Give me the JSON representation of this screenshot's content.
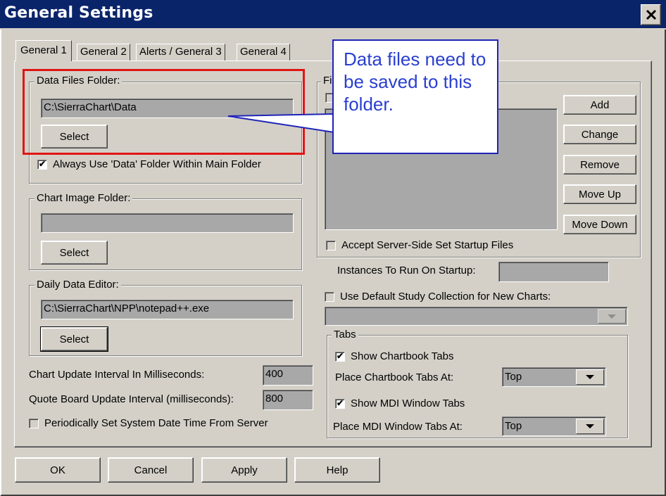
{
  "window": {
    "title": "General Settings"
  },
  "tabs": [
    "General 1",
    "General 2",
    "Alerts / General 3",
    "General 4"
  ],
  "data_files": {
    "legend": "Data Files Folder:",
    "value": "C:\\SierraChart\\Data",
    "select_label": "Select",
    "checkbox_label": "Always Use 'Data' Folder Within Main Folder",
    "checkbox_checked": true
  },
  "chart_image": {
    "legend": "Chart Image Folder:",
    "value": "",
    "select_label": "Select"
  },
  "daily_editor": {
    "legend": "Daily Data Editor:",
    "value": "C:\\SierraChart\\NPP\\notepad++.exe",
    "select_label": "Select"
  },
  "intervals": {
    "chart_update_label": "Chart Update Interval In Milliseconds:",
    "chart_update_value": "400",
    "quote_board_label": "Quote Board Update Interval (milliseconds):",
    "quote_board_value": "800"
  },
  "periodic_sync": {
    "label": "Periodically Set System Date Time From Server",
    "checked": false
  },
  "startup": {
    "legend": "Fi",
    "buttons": {
      "add": "Add",
      "change": "Change",
      "remove": "Remove",
      "move_up": "Move Up",
      "move_down": "Move Down"
    },
    "accept_label": "Accept Server-Side Set Startup Files",
    "instances_label": "Instances To Run On Startup:",
    "instances_value": ""
  },
  "study_collection": {
    "label": "Use Default Study Collection for New Charts:",
    "checked": false,
    "selected": ""
  },
  "tabs_group": {
    "legend": "Tabs",
    "show_chartbook_label": "Show Chartbook Tabs",
    "show_chartbook_checked": true,
    "place_chartbook_label": "Place Chartbook Tabs At:",
    "place_chartbook_value": "Top",
    "show_mdi_label": "Show MDI Window Tabs",
    "show_mdi_checked": true,
    "place_mdi_label": "Place MDI Window Tabs At:",
    "place_mdi_value": "Top"
  },
  "footer": {
    "ok": "OK",
    "cancel": "Cancel",
    "apply": "Apply",
    "help": "Help"
  },
  "callout": {
    "text": "Data files need to be saved to this folder."
  },
  "colors": {
    "titlebar": "#0a246a",
    "callout_border": "#1f24b8",
    "highlight": "#e01515"
  }
}
